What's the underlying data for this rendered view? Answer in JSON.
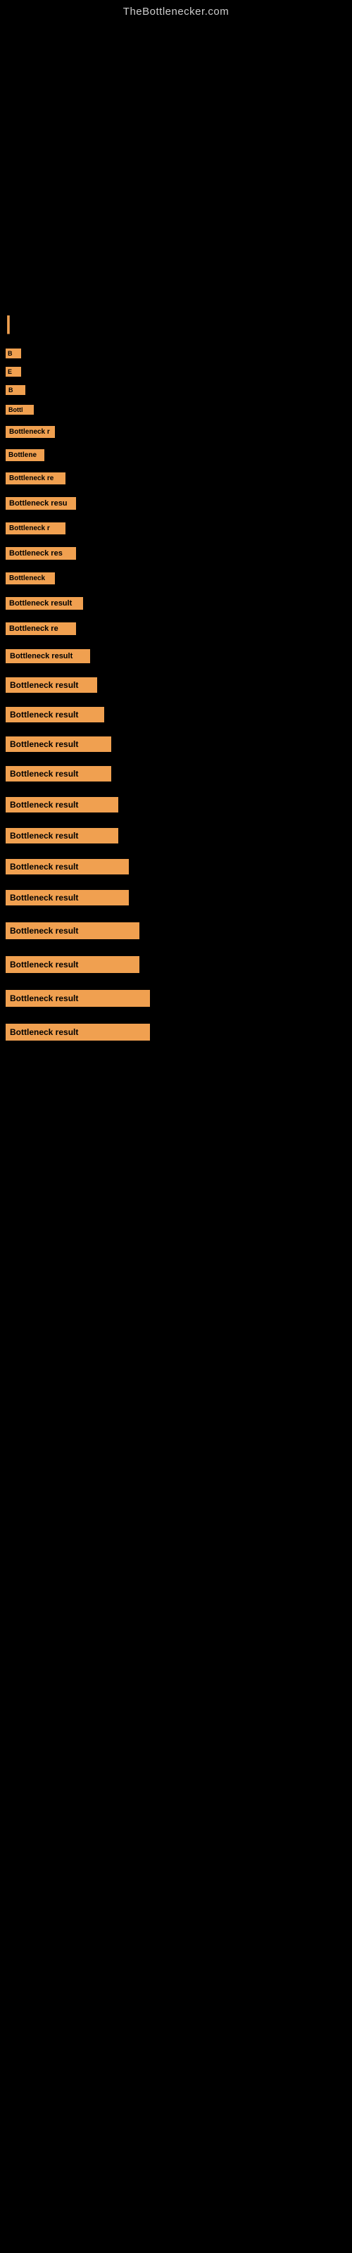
{
  "site": {
    "title": "TheBottlenecker.com"
  },
  "bars": [
    {
      "id": "bar1",
      "label": "|",
      "class": "pipe-char",
      "is_pipe": true
    },
    {
      "id": "bar2",
      "label": "B",
      "class": "bar-tiny"
    },
    {
      "id": "bar3",
      "label": "E",
      "class": "bar-tiny"
    },
    {
      "id": "bar4",
      "label": "B",
      "class": "bar-small"
    },
    {
      "id": "bar5",
      "label": "Bottl",
      "class": "bar-s1"
    },
    {
      "id": "bar6",
      "label": "Bottleneck r",
      "class": "bar-m1"
    },
    {
      "id": "bar7",
      "label": "Bottlene",
      "class": "bar-m0"
    },
    {
      "id": "bar8",
      "label": "Bottleneck re",
      "class": "bar-m2"
    },
    {
      "id": "bar9",
      "label": "Bottleneck resu",
      "class": "bar-m3"
    },
    {
      "id": "bar10",
      "label": "Bottleneck r",
      "class": "bar-m2"
    },
    {
      "id": "bar11",
      "label": "Bottleneck res",
      "class": "bar-m3"
    },
    {
      "id": "bar12",
      "label": "Bottleneck",
      "class": "bar-m1"
    },
    {
      "id": "bar13",
      "label": "Bottleneck result",
      "class": "bar-m4"
    },
    {
      "id": "bar14",
      "label": "Bottleneck re",
      "class": "bar-m3"
    },
    {
      "id": "bar15",
      "label": "Bottleneck result",
      "class": "bar-l1"
    },
    {
      "id": "bar16",
      "label": "Bottleneck result",
      "class": "bar-l2"
    },
    {
      "id": "bar17",
      "label": "Bottleneck result",
      "class": "bar-l3"
    },
    {
      "id": "bar18",
      "label": "Bottleneck result",
      "class": "bar-l4"
    },
    {
      "id": "bar19",
      "label": "Bottleneck result",
      "class": "bar-l4"
    },
    {
      "id": "bar20",
      "label": "Bottleneck result",
      "class": "bar-l5"
    },
    {
      "id": "bar21",
      "label": "Bottleneck result",
      "class": "bar-l5"
    },
    {
      "id": "bar22",
      "label": "Bottleneck result",
      "class": "bar-xl"
    },
    {
      "id": "bar23",
      "label": "Bottleneck result",
      "class": "bar-xl"
    },
    {
      "id": "bar24",
      "label": "Bottleneck result",
      "class": "bar-xxl"
    },
    {
      "id": "bar25",
      "label": "Bottleneck result",
      "class": "bar-xxl"
    },
    {
      "id": "bar26",
      "label": "Bottleneck result",
      "class": "bar-full"
    },
    {
      "id": "bar27",
      "label": "Bottleneck result",
      "class": "bar-full"
    }
  ]
}
